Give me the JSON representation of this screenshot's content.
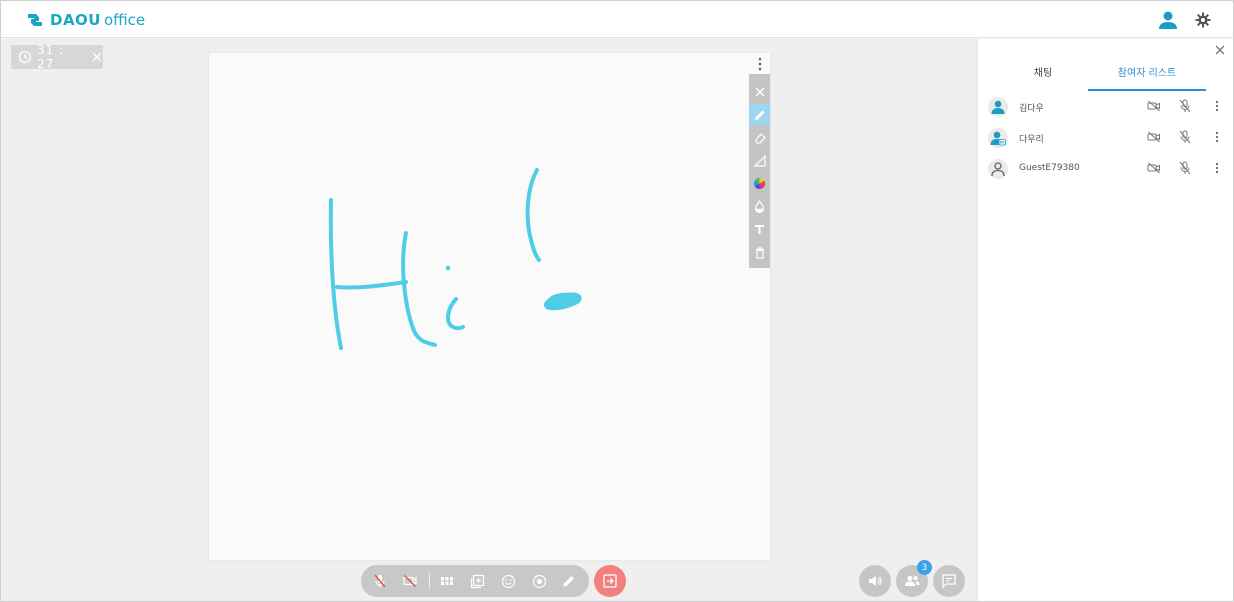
{
  "app": {
    "logo_bold": "DAOU",
    "logo_light": "office",
    "brand_color": "#1aa7c4"
  },
  "header": {
    "icons": [
      "user-icon",
      "gear-icon"
    ]
  },
  "timer": {
    "value": "31 : 27"
  },
  "whiteboard": {
    "stroke_color": "#4fcde6",
    "tools": [
      "close-icon",
      "pen-icon",
      "eraser-icon",
      "line-icon",
      "color-wheel-icon",
      "opacity-drop-icon",
      "text-icon",
      "trash-icon"
    ],
    "active_tool": "pen-icon"
  },
  "controls": {
    "icons": [
      "mic-off-icon",
      "camera-off-icon",
      "grid-layout-icon",
      "add-screen-icon",
      "emoji-icon",
      "record-icon",
      "pen-icon",
      "exit-icon"
    ],
    "exit_color": "#f37f7f"
  },
  "side_buttons": {
    "participants_count": "3",
    "icons": [
      "speaker-icon",
      "participants-icon",
      "chat-icon"
    ]
  },
  "panel": {
    "tabs": [
      {
        "label": "채팅",
        "active": false
      },
      {
        "label": "참여자 리스트",
        "active": true
      }
    ],
    "accent": "#2a8fd6",
    "participants": [
      {
        "name": "김다우",
        "role": "host"
      },
      {
        "name": "다우리",
        "role": "member"
      },
      {
        "name": "GuestE79380",
        "role": "guest"
      }
    ]
  }
}
